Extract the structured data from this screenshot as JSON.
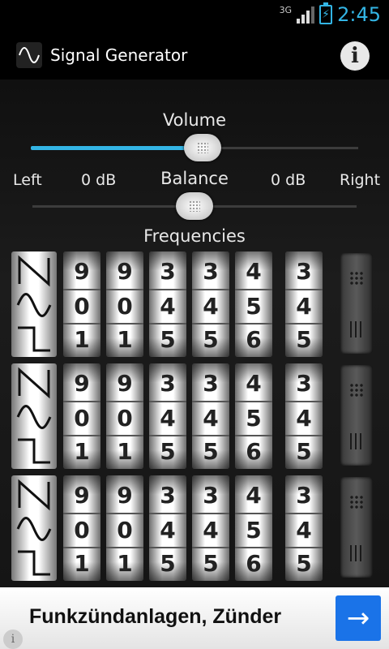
{
  "status": {
    "network": "3G",
    "time": "2:45"
  },
  "header": {
    "title": "Signal Generator",
    "info_icon": "info-icon"
  },
  "volume": {
    "label": "Volume",
    "value_fraction": 0.5
  },
  "balance": {
    "label": "Balance",
    "left_label": "Left",
    "left_db": "0 dB",
    "right_db": "0 dB",
    "right_label": "Right",
    "value_fraction": 0.5
  },
  "frequencies": {
    "label": "Frequencies",
    "rows": [
      {
        "digits": [
          [
            "9",
            "0",
            "1"
          ],
          [
            "9",
            "0",
            "1"
          ],
          [
            "3",
            "4",
            "5"
          ],
          [
            "3",
            "4",
            "5"
          ],
          [
            "4",
            "5",
            "6"
          ],
          [
            "3",
            "4",
            "5"
          ]
        ]
      },
      {
        "digits": [
          [
            "9",
            "0",
            "1"
          ],
          [
            "9",
            "0",
            "1"
          ],
          [
            "3",
            "4",
            "5"
          ],
          [
            "3",
            "4",
            "5"
          ],
          [
            "4",
            "5",
            "6"
          ],
          [
            "3",
            "4",
            "5"
          ]
        ]
      },
      {
        "digits": [
          [
            "9",
            "0",
            "1"
          ],
          [
            "9",
            "0",
            "1"
          ],
          [
            "3",
            "4",
            "5"
          ],
          [
            "3",
            "4",
            "5"
          ],
          [
            "4",
            "5",
            "6"
          ],
          [
            "3",
            "4",
            "5"
          ]
        ]
      }
    ],
    "waveforms": [
      "sawtooth-icon",
      "sine-icon",
      "square-icon"
    ]
  },
  "ad": {
    "text": "Funkzündanlagen, Zünder",
    "arrow": "→",
    "info": "i"
  },
  "colors": {
    "accent": "#33b5e5",
    "ad_button": "#1a73e8"
  }
}
